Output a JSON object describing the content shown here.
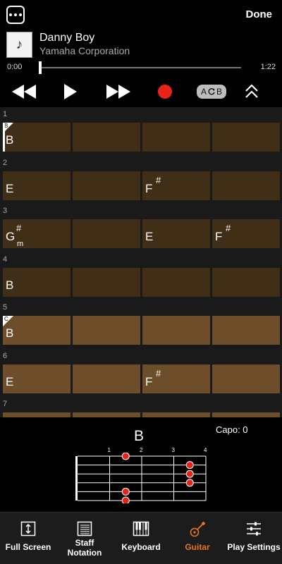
{
  "header": {
    "done_label": "Done",
    "menu_icon": "more-dots-icon"
  },
  "song": {
    "title": "Danny Boy",
    "artist": "Yamaha Corporation",
    "thumb_icon": "music-note-icon",
    "thumb_glyph": "♪"
  },
  "playback": {
    "current_time": "0:00",
    "total_time": "1:22",
    "progress": 0.0
  },
  "transport": {
    "buttons": [
      "rewind-icon",
      "play-icon",
      "fast-forward-icon",
      "record-icon",
      "ab-repeat-icon",
      "collapse-icon"
    ],
    "ab_left": "A",
    "ab_right": "B",
    "record_color": "#e8231a"
  },
  "chord_chart": {
    "rows": [
      {
        "number": "1",
        "shade": "dark",
        "marker": "B",
        "cursor": true,
        "cells": [
          {
            "root": "B",
            "acc": "",
            "qual": ""
          },
          null,
          null,
          null
        ]
      },
      {
        "number": "2",
        "shade": "dark",
        "marker": "",
        "cursor": false,
        "cells": [
          {
            "root": "E",
            "acc": "",
            "qual": ""
          },
          null,
          {
            "root": "F",
            "acc": "#",
            "qual": ""
          },
          null
        ]
      },
      {
        "number": "3",
        "shade": "dark",
        "marker": "",
        "cursor": false,
        "cells": [
          {
            "root": "G",
            "acc": "#",
            "qual": "m"
          },
          null,
          {
            "root": "E",
            "acc": "",
            "qual": ""
          },
          {
            "root": "F",
            "acc": "#",
            "qual": ""
          }
        ]
      },
      {
        "number": "4",
        "shade": "dark",
        "marker": "",
        "cursor": false,
        "cells": [
          {
            "root": "B",
            "acc": "",
            "qual": ""
          },
          null,
          null,
          null
        ]
      },
      {
        "number": "5",
        "shade": "light",
        "marker": "C",
        "cursor": false,
        "cells": [
          {
            "root": "B",
            "acc": "",
            "qual": ""
          },
          null,
          null,
          null
        ]
      },
      {
        "number": "6",
        "shade": "light",
        "marker": "",
        "cursor": false,
        "cells": [
          {
            "root": "E",
            "acc": "",
            "qual": ""
          },
          null,
          {
            "root": "F",
            "acc": "#",
            "qual": ""
          },
          null
        ]
      },
      {
        "number": "7",
        "shade": "light",
        "marker": "",
        "cursor": false,
        "cells": [
          null,
          null,
          null,
          null
        ]
      }
    ],
    "colors": {
      "dark": "#412e17",
      "light": "#6e4e2a"
    }
  },
  "guitar_diagram": {
    "chord_name": "B",
    "capo_text": "Capo: 0",
    "fret_numbers": [
      "1",
      "2",
      "3",
      "4"
    ],
    "dot_color": "#e8231a",
    "dots": [
      {
        "string": 1,
        "fret": 2
      },
      {
        "string": 2,
        "fret": 4
      },
      {
        "string": 3,
        "fret": 4
      },
      {
        "string": 4,
        "fret": 4
      },
      {
        "string": 5,
        "fret": 2
      },
      {
        "string": 6,
        "fret": 2
      }
    ]
  },
  "bottom_nav": [
    {
      "label": "Full Screen",
      "icon": "full-screen-icon",
      "active": false
    },
    {
      "label": "Staff Notation",
      "icon": "staff-notation-icon",
      "active": false
    },
    {
      "label": "Keyboard",
      "icon": "keyboard-icon",
      "active": false
    },
    {
      "label": "Guitar",
      "icon": "guitar-icon",
      "active": true
    },
    {
      "label": "Play Settings",
      "icon": "play-settings-icon",
      "active": false
    }
  ],
  "accent_color": "#e8761c"
}
